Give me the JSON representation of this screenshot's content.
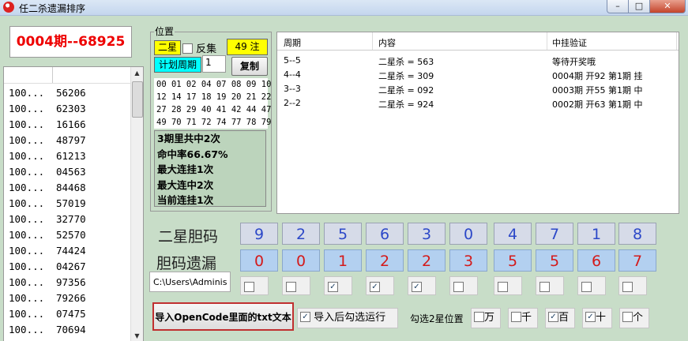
{
  "window": {
    "title": "任二杀遗漏排序",
    "min": "–",
    "max": "□",
    "close": "✕"
  },
  "current_period": "0004期--68925",
  "list": {
    "rows": [
      [
        "100...",
        "56206"
      ],
      [
        "100...",
        "62303"
      ],
      [
        "100...",
        "16166"
      ],
      [
        "100...",
        "48797"
      ],
      [
        "100...",
        "61213"
      ],
      [
        "100...",
        "04563"
      ],
      [
        "100...",
        "84468"
      ],
      [
        "100...",
        "57019"
      ],
      [
        "100...",
        "32770"
      ],
      [
        "100...",
        "52570"
      ],
      [
        "100...",
        "74424"
      ],
      [
        "100...",
        "04267"
      ],
      [
        "100...",
        "97356"
      ],
      [
        "100...",
        "79266"
      ],
      [
        "100...",
        "07475"
      ],
      [
        "100...",
        "70694"
      ]
    ]
  },
  "position": {
    "legend": "位置",
    "type": "二星",
    "reverse_label": "反集",
    "reverse_checked": false,
    "count": "49 注",
    "plan_label": "计划周期",
    "plan_value": "1",
    "copy": "复制",
    "numbers": [
      "00 01 02 04 07 08 09 10 11",
      "12 14 17 18 19 20 21 22 24",
      "27 28 29 40 41 42 44 47 48",
      "49 70 71 72 74 77 78 79 80"
    ],
    "stats": [
      "3期里共中2次",
      "命中率66.67%",
      "最大连挂1次",
      "最大连中2次",
      "当前连挂1次"
    ]
  },
  "results": {
    "headers": [
      "周期",
      "内容",
      "中挂验证"
    ],
    "rows": [
      [
        "5--5",
        "二星杀 = 563",
        "等待开奖哦"
      ],
      [
        "4--4",
        "二星杀 = 309",
        "0004期 开92 第1期 挂"
      ],
      [
        "3--3",
        "二星杀 = 092",
        "0003期 开55 第1期 中"
      ],
      [
        "2--2",
        "二星杀 = 924",
        "0002期 开63 第1期 中"
      ]
    ]
  },
  "grid": {
    "row1_label": "二星胆码",
    "row2_label": "胆码遗漏",
    "row1": [
      "9",
      "2",
      "5",
      "6",
      "3",
      "0",
      "4",
      "7",
      "1",
      "8"
    ],
    "row2": [
      "0",
      "0",
      "1",
      "2",
      "2",
      "3",
      "5",
      "5",
      "6",
      "7"
    ],
    "checks": [
      false,
      false,
      true,
      true,
      true,
      false,
      false,
      false,
      false,
      false
    ]
  },
  "bottom": {
    "path": "C:\\Users\\Adminis",
    "import": "导入OpenCode里面的txt文本",
    "run_after": "导入后勾选运行",
    "run_after_checked": true,
    "pos_label": "勾选2星位置",
    "positions": [
      {
        "label": "万",
        "checked": false
      },
      {
        "label": "千",
        "checked": false
      },
      {
        "label": "百",
        "checked": true
      },
      {
        "label": "十",
        "checked": true
      },
      {
        "label": "个",
        "checked": false
      }
    ]
  },
  "colors": {
    "bg": "#C8DDC8",
    "red_text": "#e00000",
    "blue_digit": "#2c48c8",
    "yellow": "#ffff00",
    "cyan": "#00ffff"
  }
}
